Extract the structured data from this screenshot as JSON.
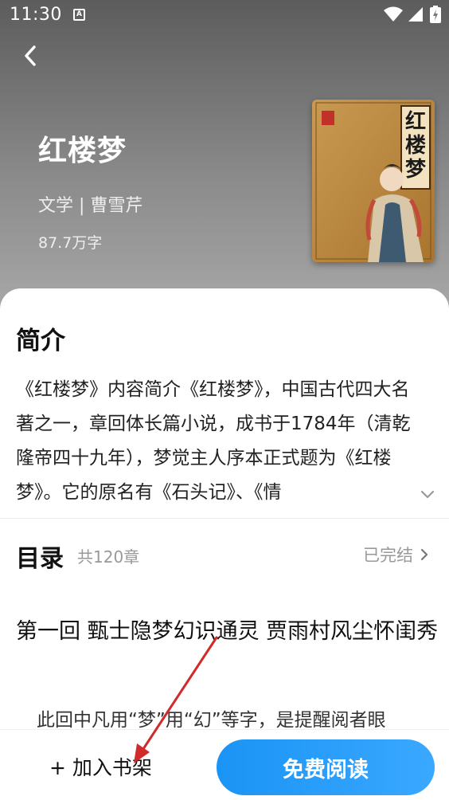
{
  "status_bar": {
    "time": "11:30",
    "icons": [
      "a-icon",
      "wifi-icon",
      "signal-icon",
      "battery-icon"
    ]
  },
  "header": {
    "back_icon": "chevron-left-icon"
  },
  "book": {
    "title": "红楼梦",
    "meta": "文学 | 曹雪芹",
    "word_count": "87.7万字",
    "cover_title": "红楼梦"
  },
  "intro": {
    "heading": "简介",
    "text": "《红楼梦》内容简介《红楼梦》，中国古代四大名著之一，章回体长篇小说，成书于1784年（清乾隆帝四十九年），梦觉主人序本正式题为《红楼梦》。它的原名有《石头记》、《情",
    "expand_icon": "chevron-down-icon"
  },
  "toc": {
    "heading": "目录",
    "count": "共120章",
    "status": "已完结"
  },
  "chapter": {
    "title": "第一回 甄士隐梦幻识通灵 贾雨村风尘怀闺秀",
    "preview": "此回中凡用“梦”用“幻”等字，是提醒阅者眼"
  },
  "bottom_bar": {
    "add_label": "+ 加入书架",
    "read_label": "免费阅读"
  },
  "colors": {
    "accent": "#1a94f5",
    "annotation": "#d12a2a"
  }
}
